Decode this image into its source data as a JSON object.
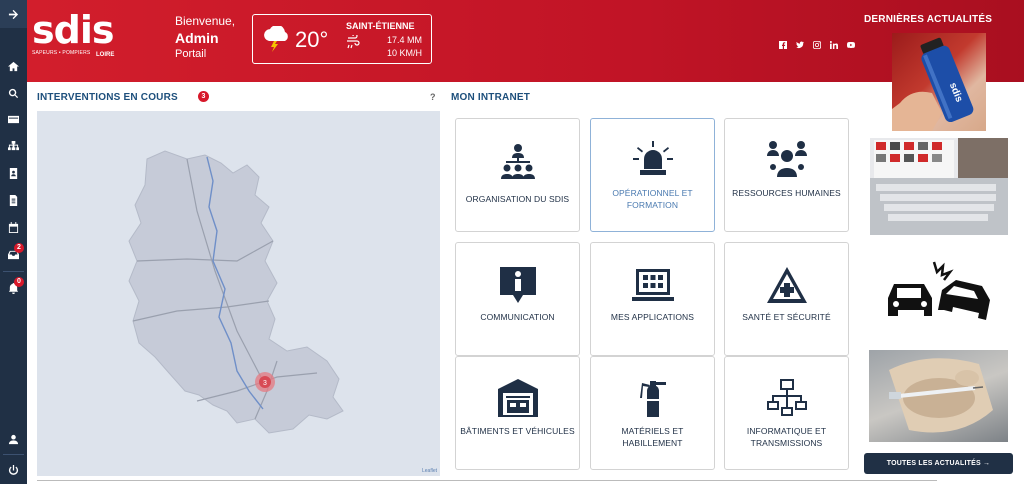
{
  "sidebar": {
    "badges": {
      "notifications": "2",
      "alerts": "0"
    }
  },
  "header": {
    "logo_text": "sdis",
    "logo_sub": "SAPEURS • POMPIERS",
    "logo_region": "LOIRE",
    "welcome": "Bienvenue,",
    "user": "Admin",
    "portal": "Portail",
    "weather": {
      "temp": "20°",
      "city": "SAINT-ÉTIENNE",
      "rain": "17.4 MM",
      "wind": "10 KM/H"
    },
    "news_title": "DERNIÈRES ACTUALITÉS"
  },
  "interventions": {
    "title": "INTERVENTIONS EN COURS",
    "count": "3",
    "help": "?",
    "marker_count": "3",
    "attribution": "Leaflet"
  },
  "intranet": {
    "title": "MON INTRANET",
    "tiles": [
      {
        "label": "ORGANISATION DU SDIS"
      },
      {
        "label": "OPÉRATIONNEL ET FORMATION"
      },
      {
        "label": "RESSOURCES HUMAINES"
      },
      {
        "label": "COMMUNICATION"
      },
      {
        "label": "MES APPLICATIONS"
      },
      {
        "label": "SANTÉ ET SÉCURITÉ"
      },
      {
        "label": "BÂTIMENTS ET VÉHICULES"
      },
      {
        "label": "MATÉRIELS ET HABILLEMENT"
      },
      {
        "label": "INFORMATIQUE ET TRANSMISSIONS"
      }
    ]
  },
  "news": {
    "bottle_text": "sdis",
    "button": "TOUTES LES ACTUALITÉS →"
  },
  "colors": {
    "brand_red": "#c8182a",
    "navy": "#203045",
    "title_blue": "#1d4f7c"
  }
}
